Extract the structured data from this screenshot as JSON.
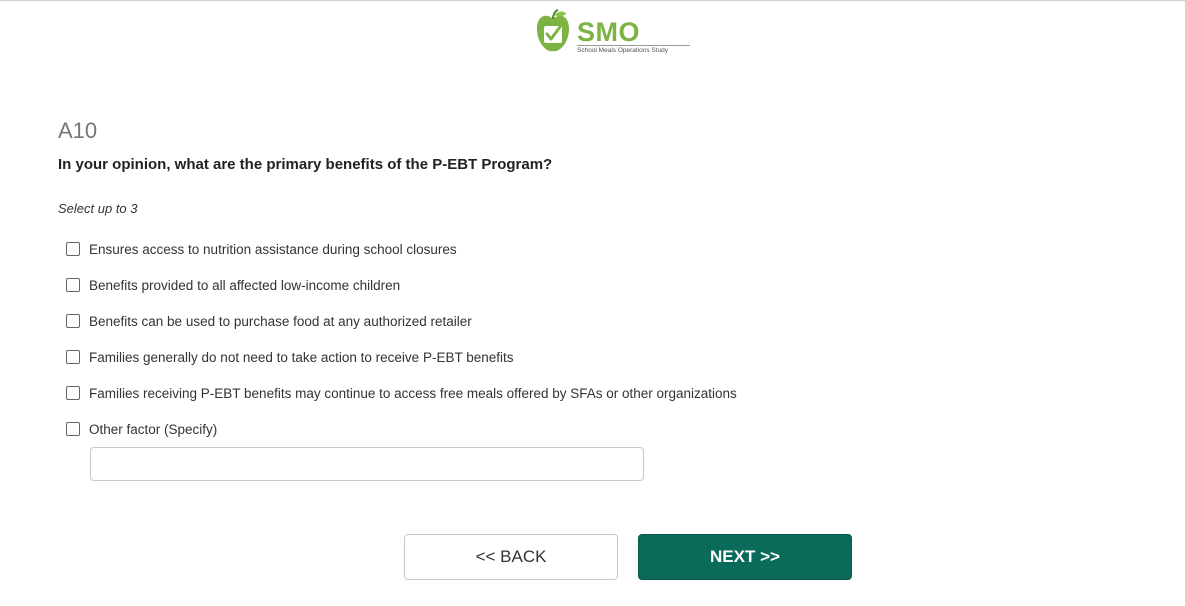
{
  "header": {
    "logo_text": "SMO",
    "logo_subtitle": "School Meals Operations Study",
    "logo_icon": "apple-checkbox-icon",
    "brand_color": "#7cb342"
  },
  "question": {
    "id": "A10",
    "text": "In your opinion, what are the primary benefits of the P-EBT Program?",
    "instruction": "Select up to 3",
    "options": [
      {
        "label": "Ensures access to nutrition assistance during school closures",
        "checked": false
      },
      {
        "label": "Benefits provided to all affected low-income children",
        "checked": false
      },
      {
        "label": "Benefits can be used to purchase food at any authorized retailer",
        "checked": false
      },
      {
        "label": "Families generally do not need to take action to receive P-EBT benefits",
        "checked": false
      },
      {
        "label": "Families receiving P-EBT benefits may continue to access free meals offered by SFAs or other organizations",
        "checked": false
      },
      {
        "label": "Other factor (Specify)",
        "checked": false
      }
    ],
    "specify_value": ""
  },
  "nav": {
    "back_label": "<< BACK",
    "next_label": "NEXT >>",
    "next_color": "#0b6b5a"
  }
}
